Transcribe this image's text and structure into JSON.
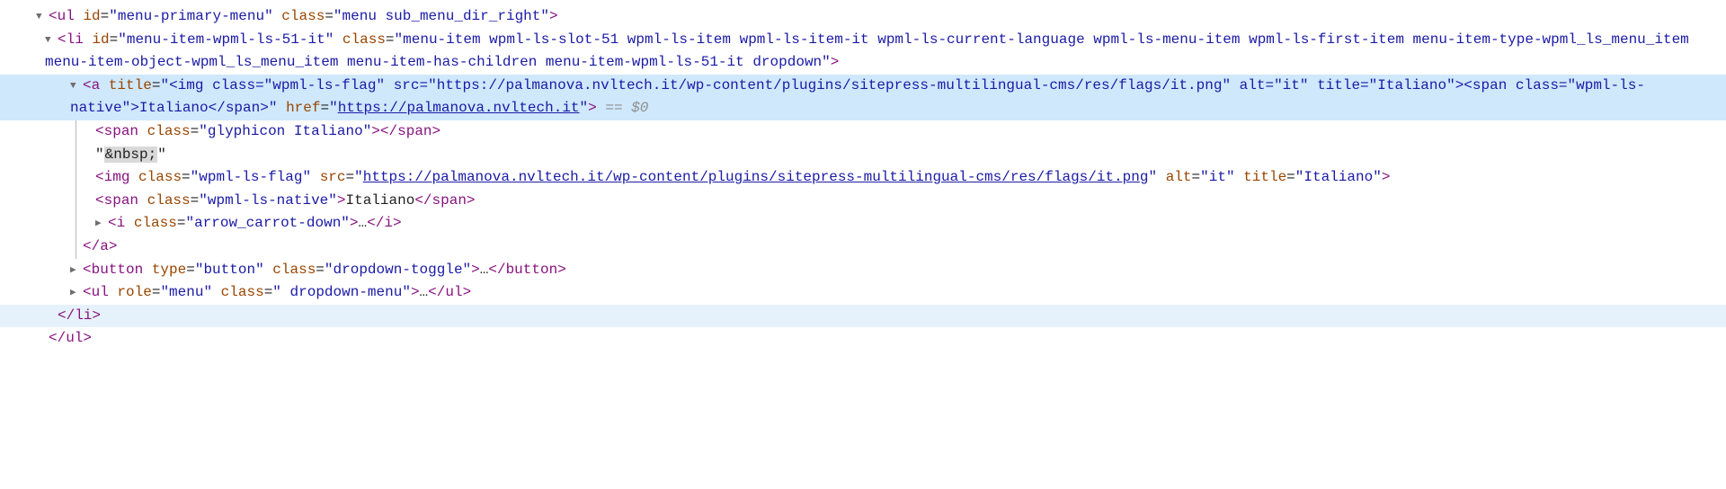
{
  "ul_tag": "ul",
  "ul_id_attr": "id",
  "ul_id_val": "menu-primary-menu",
  "ul_class_attr": "class",
  "ul_class_val": "menu sub_menu_dir_right",
  "ul_close": "ul",
  "li_tag": "li",
  "li_id_attr": "id",
  "li_id_val": "menu-item-wpml-ls-51-it",
  "li_class_attr": "class",
  "li_class_val": "menu-item wpml-ls-slot-51 wpml-ls-item wpml-ls-item-it wpml-ls-current-language wpml-ls-menu-item wpml-ls-first-item menu-item-type-wpml_ls_menu_item menu-item-object-wpml_ls_menu_item menu-item-has-children menu-item-wpml-ls-51-it dropdown",
  "li_close": "li",
  "a_tag": "a",
  "a_title_attr": "title",
  "a_title_val": "<img class=\"wpml-ls-flag\" src=\"https://palmanova.nvltech.it/wp-content/plugins/sitepress-multilingual-cms/res/flags/it.png\" alt=\"it\" title=\"Italiano\"><span class=\"wpml-ls-native\">Italiano</span>",
  "a_href_attr": "href",
  "a_href_val": "https://palmanova.nvltech.it",
  "a_close": "a",
  "sel_marker": " == $0",
  "span1_tag": "span",
  "span1_class_attr": "class",
  "span1_class_val": "glyphicon Italiano",
  "span1_close": "span",
  "nbsp_text": "&nbsp;",
  "img_tag": "img",
  "img_class_attr": "class",
  "img_class_val": "wpml-ls-flag",
  "img_src_attr": "src",
  "img_src_val": "https://palmanova.nvltech.it/wp-content/plugins/sitepress-multilingual-cms/res/flags/it.png",
  "img_alt_attr": "alt",
  "img_alt_val": "it",
  "img_title_attr": "title",
  "img_title_val": "Italiano",
  "span2_tag": "span",
  "span2_class_attr": "class",
  "span2_class_val": "wpml-ls-native",
  "span2_text": "Italiano",
  "span2_close": "span",
  "i_tag": "i",
  "i_class_attr": "class",
  "i_class_val": "arrow_carrot-down",
  "i_close": "i",
  "button_tag": "button",
  "button_type_attr": "type",
  "button_type_val": "button",
  "button_class_attr": "class",
  "button_class_val": "dropdown-toggle",
  "button_close": "button",
  "ul2_tag": "ul",
  "ul2_role_attr": "role",
  "ul2_role_val": "menu",
  "ul2_class_attr": "class",
  "ul2_class_val": " dropdown-menu",
  "ul2_close": "ul",
  "ellipsis": "…"
}
